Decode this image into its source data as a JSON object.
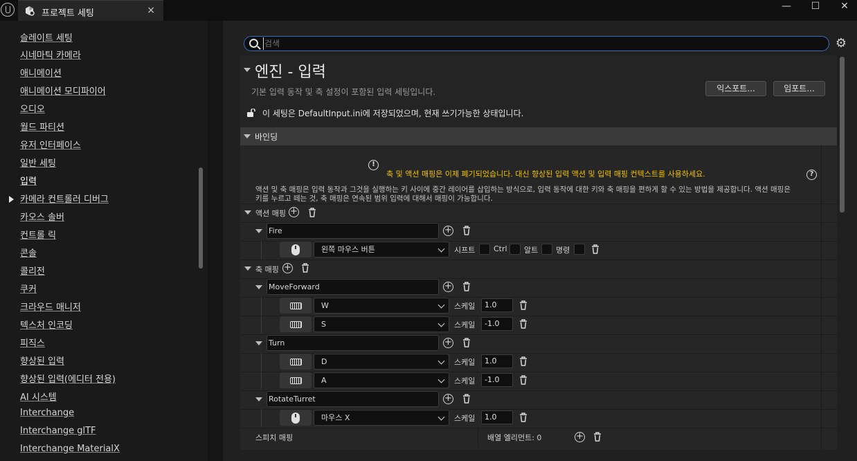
{
  "window": {
    "tab_title": "프로젝트 세팅",
    "tab_close": "×",
    "minimize": "—",
    "maximize": "☐",
    "close": "✕"
  },
  "sidebar": {
    "items": [
      {
        "label": "슬레이트 세팅"
      },
      {
        "label": "시네마틱 카메라"
      },
      {
        "label": "애니메이션"
      },
      {
        "label": "애니메이션 모디파이어"
      },
      {
        "label": "오디오"
      },
      {
        "label": "월드 파티션"
      },
      {
        "label": "유저 인터페이스"
      },
      {
        "label": "일반 세팅"
      },
      {
        "label": "입력",
        "selected": true
      },
      {
        "label": "카메라 컨트롤러 디버그"
      },
      {
        "label": "카오스 솔버"
      },
      {
        "label": "컨트롤 릭"
      },
      {
        "label": "콘솔"
      },
      {
        "label": "콜리전"
      },
      {
        "label": "쿠커"
      },
      {
        "label": "크라우드 매니저"
      },
      {
        "label": "텍스처 인코딩"
      },
      {
        "label": "피직스"
      },
      {
        "label": "향상된 입력"
      },
      {
        "label": "향상된 입력(에디터 전용)"
      },
      {
        "label": "AI 시스템"
      },
      {
        "label": "Interchange"
      },
      {
        "label": "Interchange glTF"
      },
      {
        "label": "Interchange MaterialX"
      }
    ]
  },
  "search": {
    "placeholder": "검색",
    "value": ""
  },
  "header": {
    "title": "엔진 - 입력",
    "description": "기본 입력 동작 및 축 설정이 포함된 입력 세팅입니다.",
    "export_label": "익스포트...",
    "import_label": "임포트...",
    "saved_note": "이 세팅은 DefaultInput.ini에 저장되었으며, 현재 쓰기가능한 상태입니다."
  },
  "bindings": {
    "title": "바인딩",
    "notice_icon": "!",
    "help_icon": "?",
    "deprecation_notice": "축 및 액션 매핑은 이제 폐기되었습니다. 대신 향상된 입력 액션 및 입력 매핑 컨텍스트를 사용하세요.",
    "description_line1": "액션 및 축 매핑은 입력 동작과 그것을 실행하는 키 사이에 중간 레이어를 삽입하는 방식으로, 입력 동작에 대한 키와 축 매핑을 편하게 할 수 있는 방법을 제공합니다. 액션 매핑은",
    "description_line2": "키를 누르고 떼는 것, 축 매핑은 연속된 범위 입력에 대해서 매핑이 가능합니다.",
    "action_mappings_label": "액션 매핑",
    "axis_mappings_label": "축 매핑",
    "shift_label": "시프트",
    "ctrl_label": "Ctrl",
    "alt_label": "알트",
    "cmd_label": "명령",
    "scale_label": "스케일",
    "speech_mappings_label": "스피치 매핑",
    "array_elements_label": "배열 엘리먼트: 0",
    "actions": [
      {
        "name": "Fire",
        "keys": [
          {
            "key": "왼쪽 마우스 버튼",
            "icon": "mouse-icon"
          }
        ]
      }
    ],
    "axes": [
      {
        "name": "MoveForward",
        "keys": [
          {
            "key": "W",
            "scale": "1.0",
            "icon": "keyboard-icon"
          },
          {
            "key": "S",
            "scale": "-1.0",
            "icon": "keyboard-icon"
          }
        ]
      },
      {
        "name": "Turn",
        "keys": [
          {
            "key": "D",
            "scale": "1.0",
            "icon": "keyboard-icon"
          },
          {
            "key": "A",
            "scale": "-1.0",
            "icon": "keyboard-icon"
          }
        ]
      },
      {
        "name": "RotateTurret",
        "keys": [
          {
            "key": "마우스 X",
            "scale": "1.0",
            "icon": "mouse-icon"
          }
        ]
      }
    ]
  },
  "colors": {
    "accent": "#2e6fbd",
    "warning": "#f2c200",
    "background": "#202020"
  }
}
